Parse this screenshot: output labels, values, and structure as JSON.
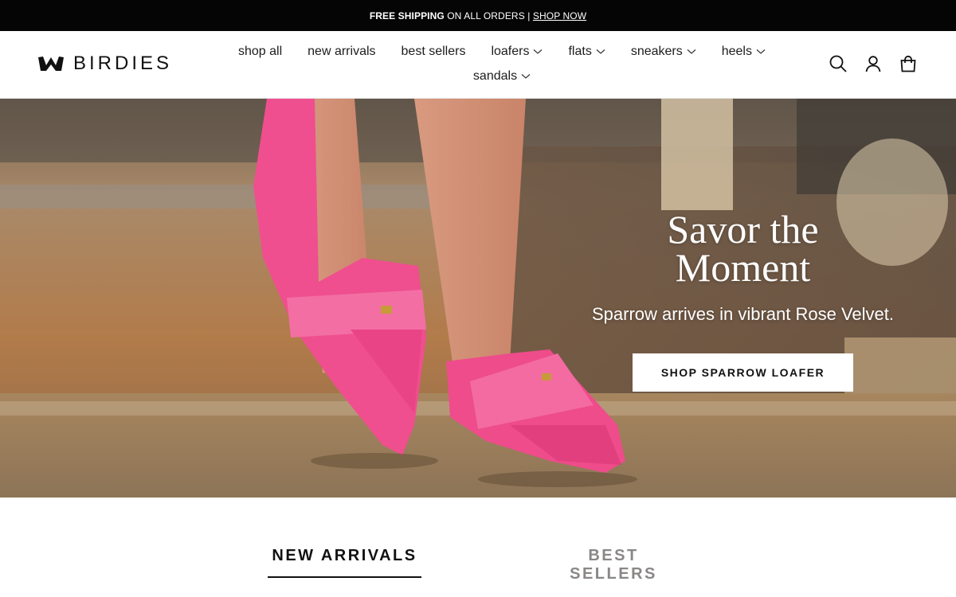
{
  "announcement": {
    "bold_text": "FREE SHIPPING",
    "text": "ON ALL ORDERS |",
    "link": "SHOP NOW"
  },
  "header": {
    "logo_text": "BIRDIES",
    "nav": [
      {
        "label": "shop all"
      },
      {
        "label": "new arrivals"
      },
      {
        "label": "best sellers"
      },
      {
        "label": "loafers"
      },
      {
        "label": "flats"
      },
      {
        "label": "sneakers"
      },
      {
        "label": "heels"
      },
      {
        "label": "sandals"
      }
    ],
    "icons": [
      "search-icon",
      "account-icon",
      "cart-icon"
    ]
  },
  "hero": {
    "title_line1": "Savor the",
    "title_line2": "Moment",
    "subtitle": "Sparrow arrives in vibrant Rose Velvet.",
    "cta": "SHOP SPARROW LOAFER"
  },
  "tabs": [
    {
      "label": "NEW ARRIVALS"
    },
    {
      "label": "BEST SELLERS"
    }
  ],
  "colors": {
    "announcement_bg": "#050505",
    "shoe_pink": "#f0508f",
    "tab_inactive": "#8a8786"
  }
}
